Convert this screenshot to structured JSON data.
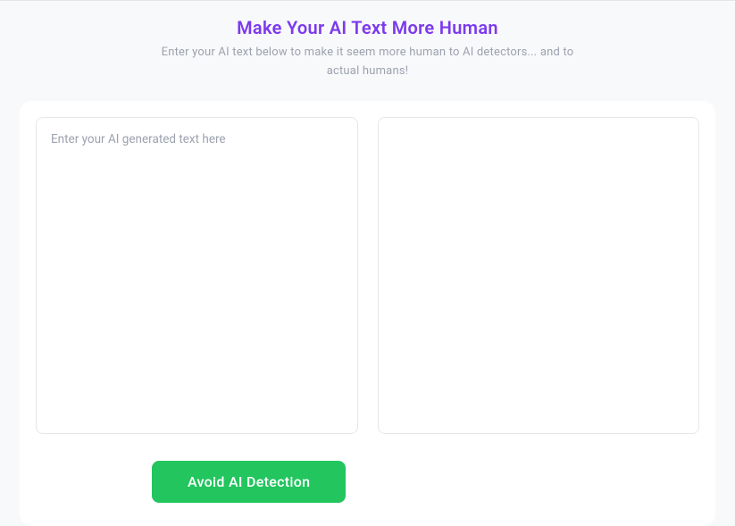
{
  "header": {
    "title": "Make Your AI Text More Human",
    "subtitle": "Enter your AI text below to make it seem more human to AI detectors... and to actual humans!"
  },
  "input": {
    "placeholder": "Enter your AI generated text here",
    "value": ""
  },
  "output": {
    "value": ""
  },
  "action": {
    "primary_label": "Avoid AI Detection"
  },
  "colors": {
    "accent_purple": "#7c3aed",
    "primary_green": "#22c55e",
    "muted_text": "#9ca3af"
  }
}
